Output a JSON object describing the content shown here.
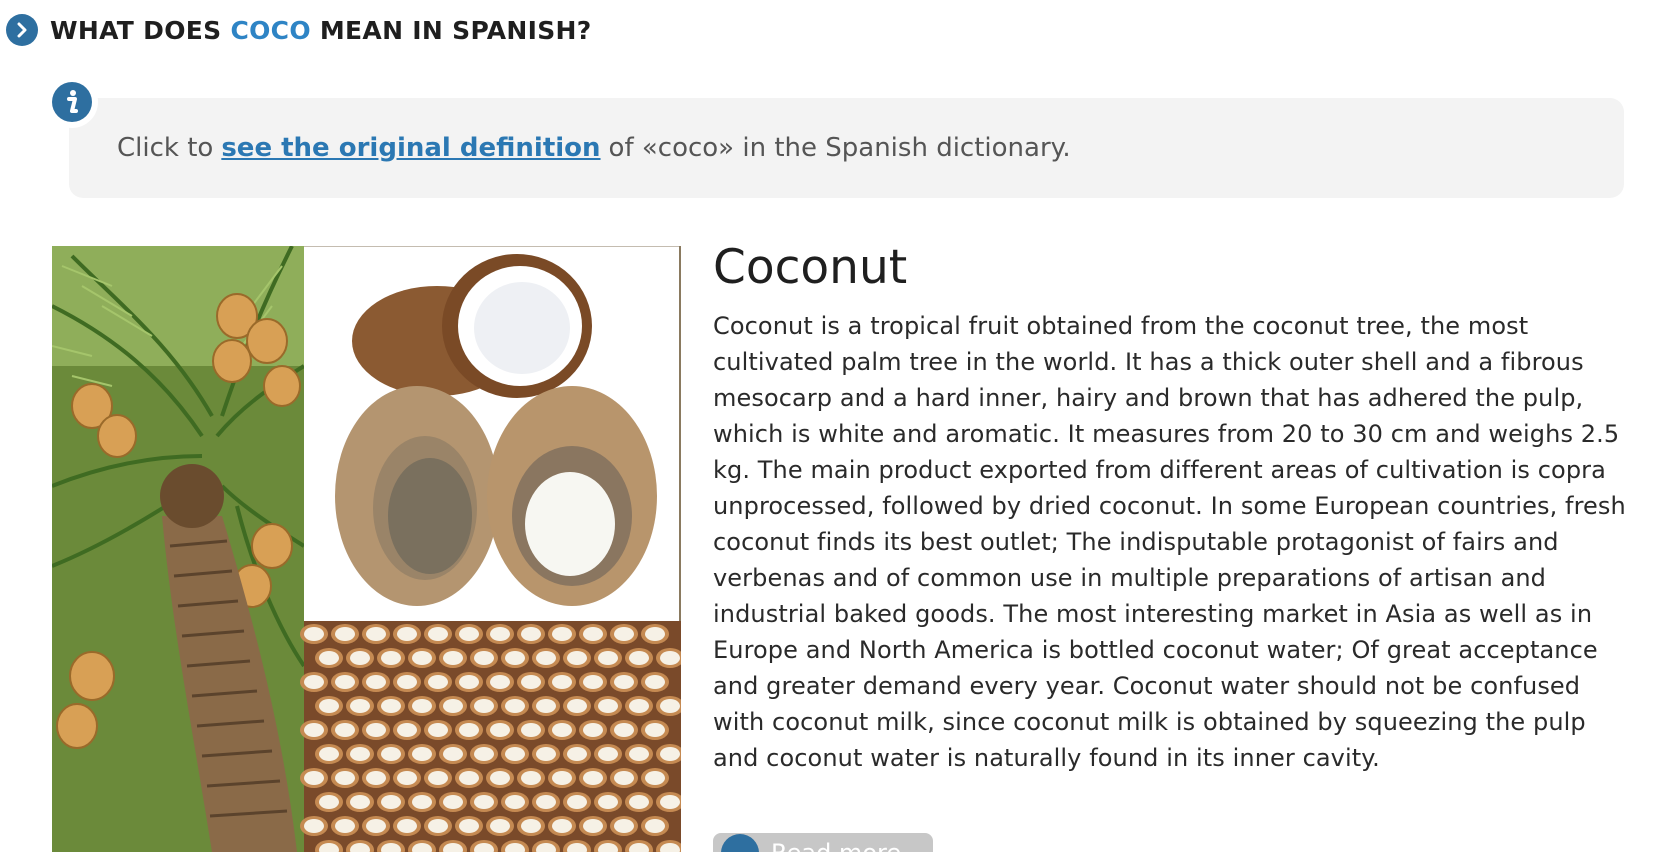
{
  "heading": {
    "prefix": "WHAT DOES ",
    "word": "COCO",
    "suffix": " MEAN IN SPANISH?",
    "icon": "chevron-right-icon"
  },
  "info": {
    "icon": "info-icon",
    "before": "Click to",
    "link": "see the original definition",
    "after": "of «coco» in the Spanish dictionary."
  },
  "article": {
    "title": "Coconut",
    "body": "Coconut is a tropical fruit obtained from the coconut tree, the most cultivated palm tree in the world. It has a thick outer shell and a fibrous mesocarp and a hard inner, hairy and brown that has adhered the pulp, which is white and aromatic. It measures from 20 to 30 cm and weighs 2.5 kg. The main product exported from different areas of cultivation is copra unprocessed, followed by dried coconut. In some European countries, fresh coconut finds its best outlet; The indisputable protagonist of fairs and verbenas and of common use in multiple preparations of artisan and industrial baked goods. The most interesting market in Asia as well as in Europe and North America is bottled coconut water; Of great acceptance and greater demand every year. Coconut water should not be confused with coconut milk, since coconut milk is obtained by squeezing the pulp and coconut water is naturally found in its inner cavity.",
    "read_more": "Read more"
  },
  "colors": {
    "accent": "#2e84c5",
    "icon_blue": "#2e6fa0",
    "link": "#2b78b3",
    "info_bg": "#f3f3f3"
  }
}
